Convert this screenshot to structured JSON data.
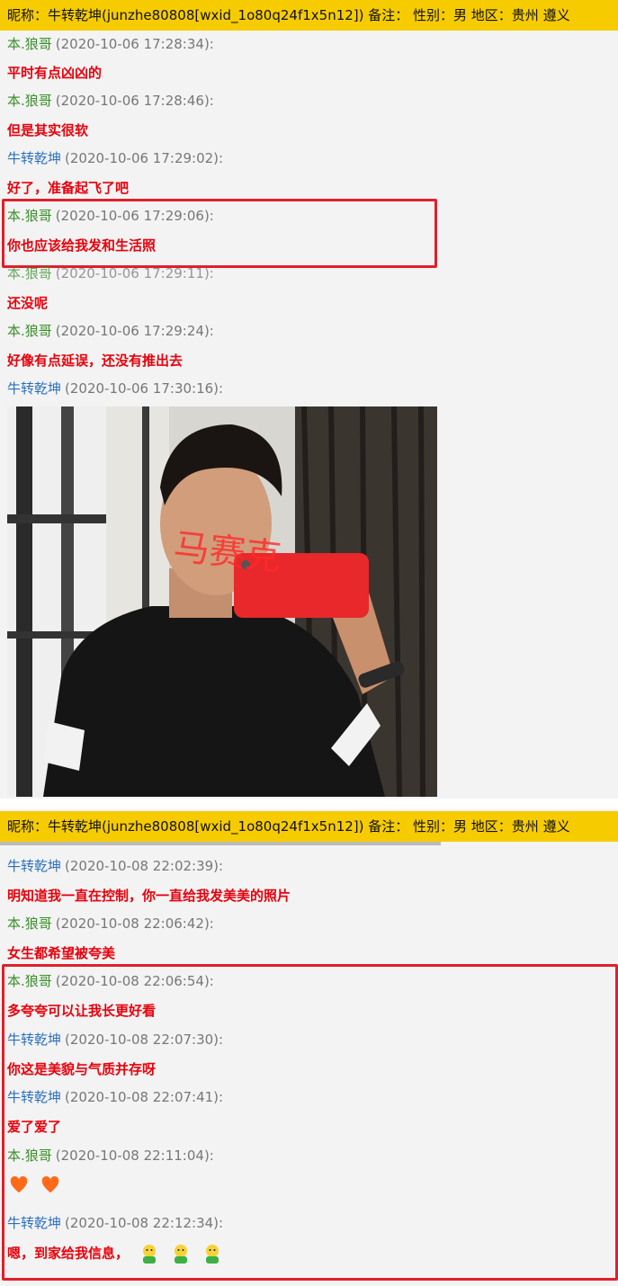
{
  "header1": {
    "text": "昵称：牛转乾坤(junzhe80808[wxid_1o80q24f1x5n12])  备注：   性别：男  地区：贵州 遵义"
  },
  "header2": {
    "text": "昵称：牛转乾坤(junzhe80808[wxid_1o80q24f1x5n12])  备注：   性别：男  地区：贵州 遵义"
  },
  "messages1": [
    {
      "name": "本.狼哥",
      "time": "(2020-10-06 17:28:34):",
      "text": "平时有点凶凶的"
    },
    {
      "name": "本.狼哥",
      "time": "(2020-10-06 17:28:46):",
      "text": "但是其实很软"
    },
    {
      "name": "牛转乾坤",
      "time": "(2020-10-06 17:29:02):",
      "text": "好了，准备起飞了吧"
    },
    {
      "name": "本.狼哥",
      "time": "(2020-10-06 17:29:06):",
      "text": "你也应该给我发和生活照"
    },
    {
      "name": "本.狼哥",
      "time": "(2020-10-06 17:29:11):",
      "text": "还没呢"
    },
    {
      "name": "本.狼哥",
      "time": "(2020-10-06 17:29:24):",
      "text": "好像有点延误，还没有推出去"
    },
    {
      "name": "牛转乾坤",
      "time": "(2020-10-06 17:30:16):",
      "text": ""
    }
  ],
  "photo": {
    "watermark": "马赛克"
  },
  "messages2": [
    {
      "name": "牛转乾坤",
      "time": "(2020-10-08 22:02:39):",
      "text": "明知道我一直在控制，你一直给我发美美的照片"
    },
    {
      "name": "本.狼哥",
      "time": "(2020-10-08 22:06:42):",
      "text": "女生都希望被夸美"
    },
    {
      "name": "本.狼哥",
      "time": "(2020-10-08 22:06:54):",
      "text": "多夸夸可以让我长更好看"
    },
    {
      "name": "牛转乾坤",
      "time": "(2020-10-08 22:07:30):",
      "text": "你这是美貌与气质并存呀"
    },
    {
      "name": "牛转乾坤",
      "time": "(2020-10-08 22:07:41):",
      "text": "爱了爱了"
    },
    {
      "name": "本.狼哥",
      "time": "(2020-10-08 22:11:04):",
      "text": ""
    },
    {
      "name": "牛转乾坤",
      "time": "(2020-10-08 22:12:34):",
      "text": "嗯，到家给我信息，"
    }
  ],
  "colors": {
    "header_bg": "#f6cc00",
    "name_green": "#3a8f2a",
    "name_blue": "#2a6fbf",
    "msg_red": "#e8000b",
    "highlight_border": "#e0202a"
  }
}
